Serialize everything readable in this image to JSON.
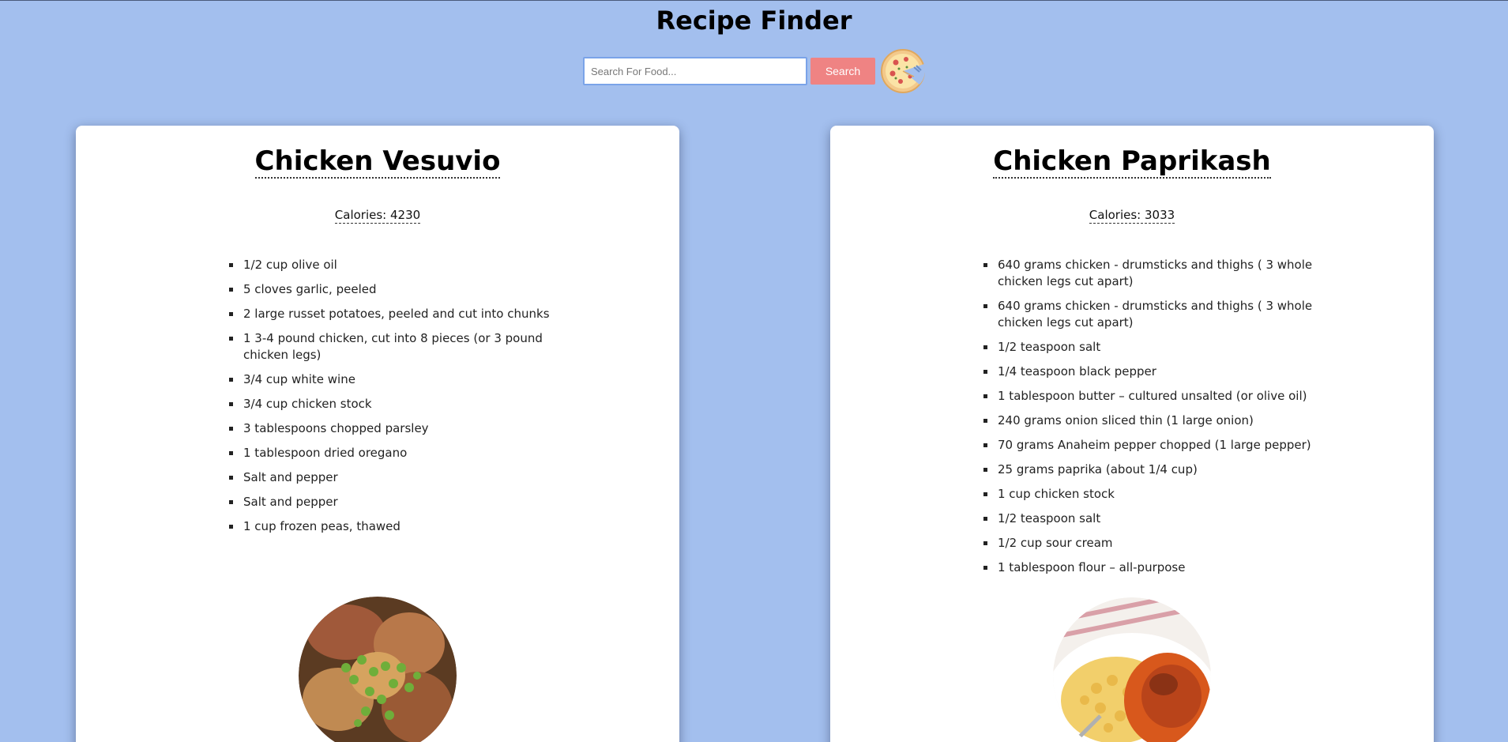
{
  "header": {
    "title": "Recipe Finder"
  },
  "search": {
    "placeholder": "Search For Food...",
    "value": "",
    "button_label": "Search",
    "logo_icon": "pizza-icon"
  },
  "recipes": [
    {
      "title": "Chicken Vesuvio",
      "calories": "Calories: 4230",
      "ingredients": [
        "1/2 cup olive oil",
        "5 cloves garlic, peeled",
        "2 large russet potatoes, peeled and cut into chunks",
        "1 3-4 pound chicken, cut into 8 pieces (or 3 pound chicken legs)",
        "3/4 cup white wine",
        "3/4 cup chicken stock",
        "3 tablespoons chopped parsley",
        "1 tablespoon dried oregano",
        "Salt and pepper",
        "Salt and pepper",
        "1 cup frozen peas, thawed"
      ],
      "image_icon": "chicken-vesuvio-photo"
    },
    {
      "title": "Chicken Paprikash",
      "calories": "Calories: 3033",
      "ingredients": [
        "640 grams chicken - drumsticks and thighs ( 3 whole chicken legs cut apart)",
        "640 grams chicken - drumsticks and thighs ( 3 whole chicken legs cut apart)",
        "1/2 teaspoon salt",
        "1/4 teaspoon black pepper",
        "1 tablespoon butter – cultured unsalted (or olive oil)",
        "240 grams onion sliced thin (1 large onion)",
        "70 grams Anaheim pepper chopped (1 large pepper)",
        "25 grams paprika (about 1/4 cup)",
        "1 cup chicken stock",
        "1/2 teaspoon salt",
        "1/2 cup sour cream",
        "1 tablespoon flour – all-purpose"
      ],
      "image_icon": "chicken-paprikash-photo"
    }
  ],
  "colors": {
    "background": "#a3bfee",
    "search_button": "#ef8383",
    "card": "#ffffff"
  }
}
